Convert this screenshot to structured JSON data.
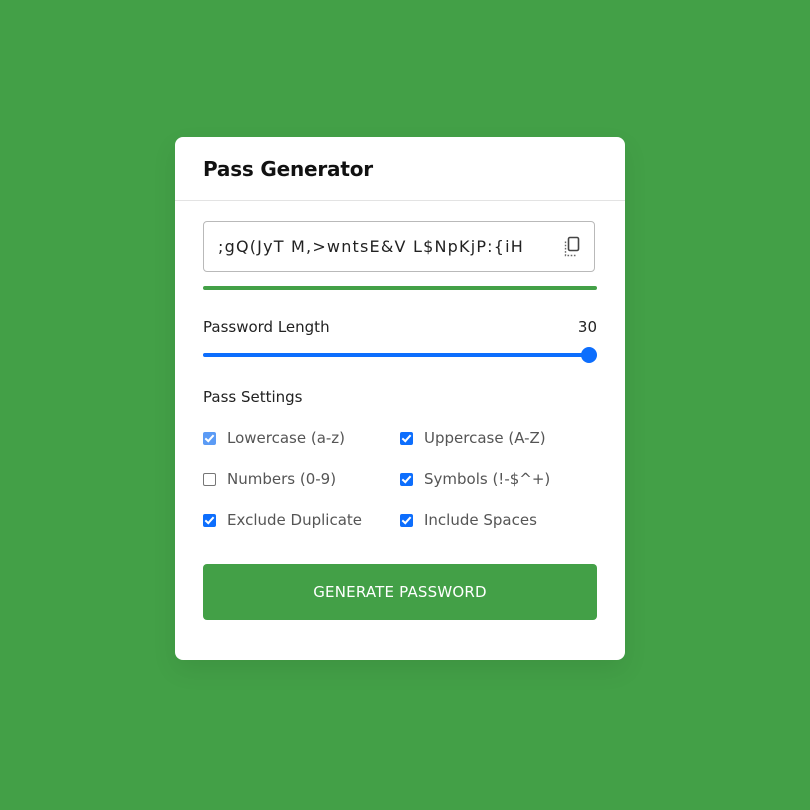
{
  "app": {
    "title": "Pass Generator"
  },
  "password": {
    "value": ";gQ(JyT M,>wntsE&V L$NpKjP:{iH",
    "copy_icon": "copy-icon"
  },
  "strength": {
    "level": 1.0,
    "color": "#43a047"
  },
  "length": {
    "label": "Password Length",
    "value": "30",
    "slider_fraction": 1.0
  },
  "settings": {
    "label": "Pass Settings",
    "options": [
      {
        "label": "Lowercase (a-z)",
        "checked": true,
        "disabled": true
      },
      {
        "label": "Uppercase (A-Z)",
        "checked": true,
        "disabled": false
      },
      {
        "label": "Numbers (0-9)",
        "checked": false,
        "disabled": false
      },
      {
        "label": "Symbols (!-$^+)",
        "checked": true,
        "disabled": false
      },
      {
        "label": "Exclude Duplicate",
        "checked": true,
        "disabled": false
      },
      {
        "label": "Include Spaces",
        "checked": true,
        "disabled": false
      }
    ]
  },
  "button": {
    "label": "GENERATE PASSWORD"
  },
  "colors": {
    "background": "#43a047",
    "accent": "#0d6efd",
    "card": "#ffffff"
  }
}
